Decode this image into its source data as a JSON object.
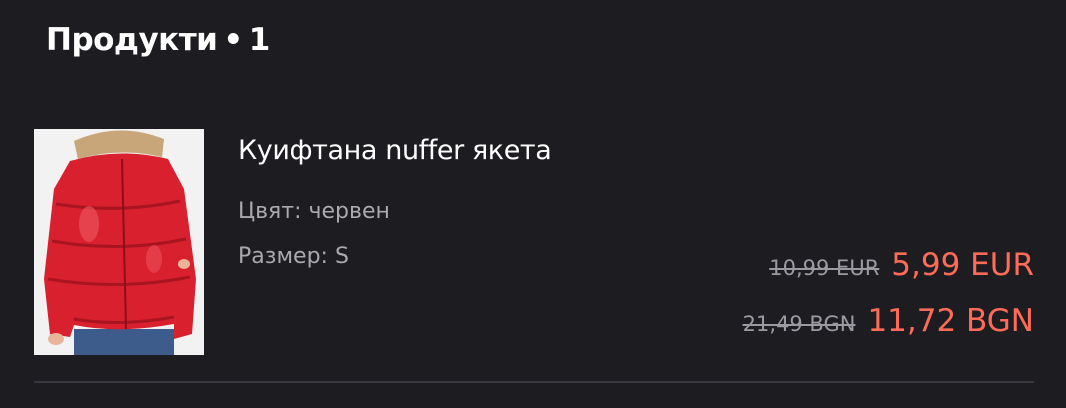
{
  "section": {
    "title": "Продукти",
    "dot": "•",
    "count": "1"
  },
  "product": {
    "name": "Куифтана nuffer якета",
    "color_label": "Цвят: червен",
    "size_label": "Размер: S",
    "image_subject": "red puffer jacket with fur hood",
    "prices": {
      "eur": {
        "old": "10,99 EUR",
        "new": "5,99 EUR"
      },
      "bgn": {
        "old": "21,49 BGN",
        "new": "11,72 BGN"
      }
    }
  },
  "colors": {
    "background": "#1c1c21",
    "sale_price": "#ff6b57",
    "muted_text": "#a9a9ae",
    "jacket": "#d8202e"
  }
}
